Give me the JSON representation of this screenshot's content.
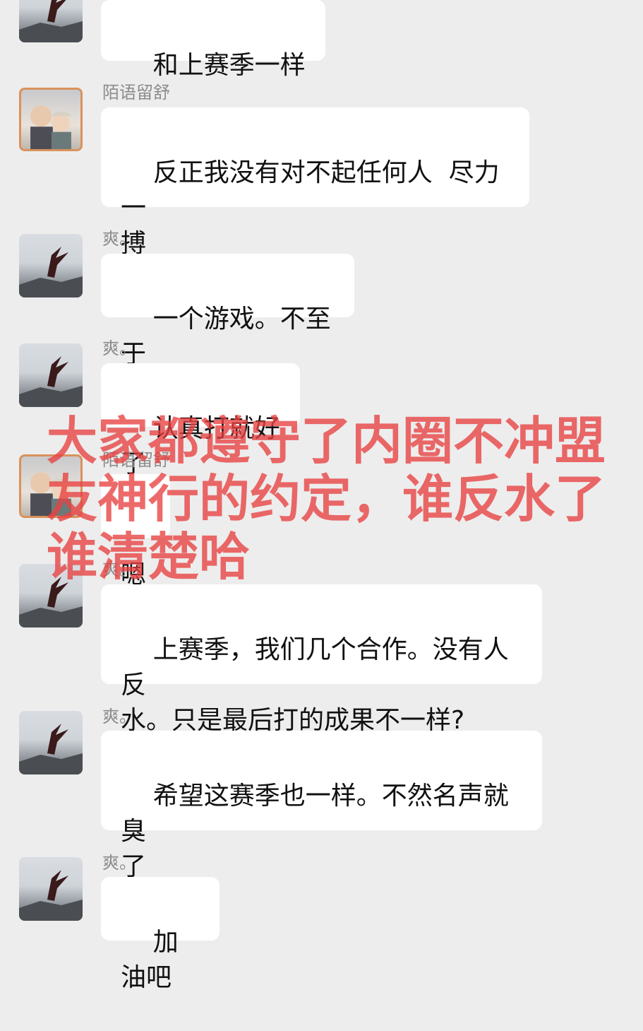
{
  "messages": [
    {
      "sender": "",
      "avatar": "bird-avatar",
      "text": "和上赛季一样"
    },
    {
      "sender": "陌语留舒",
      "avatar": "couple-avatar",
      "text": "反正我没有对不起任何人  尽力一\n搏"
    },
    {
      "sender": "爽。",
      "avatar": "bird-avatar",
      "text": "一个游戏。不至于"
    },
    {
      "sender": "爽。",
      "avatar": "bird-avatar",
      "text": "认真打就好了"
    },
    {
      "sender": "陌语留舒",
      "avatar": "couple-avatar",
      "text": "嗯"
    },
    {
      "sender": "爽。",
      "avatar": "bird-avatar",
      "text": "上赛季，我们几个合作。没有人反\n水。只是最后打的成果不一样?"
    },
    {
      "sender": "爽。",
      "avatar": "bird-avatar",
      "text": "希望这赛季也一样。不然名声就臭\n了"
    },
    {
      "sender": "爽。",
      "avatar": "bird-avatar",
      "text": "加油吧"
    }
  ],
  "overlay_text": "大家都遵守了内圈不冲盟\n友神行的约定，谁反水了\n谁清楚哈",
  "colors": {
    "background": "#ededed",
    "bubble": "#ffffff",
    "overlay": "#e84040"
  }
}
